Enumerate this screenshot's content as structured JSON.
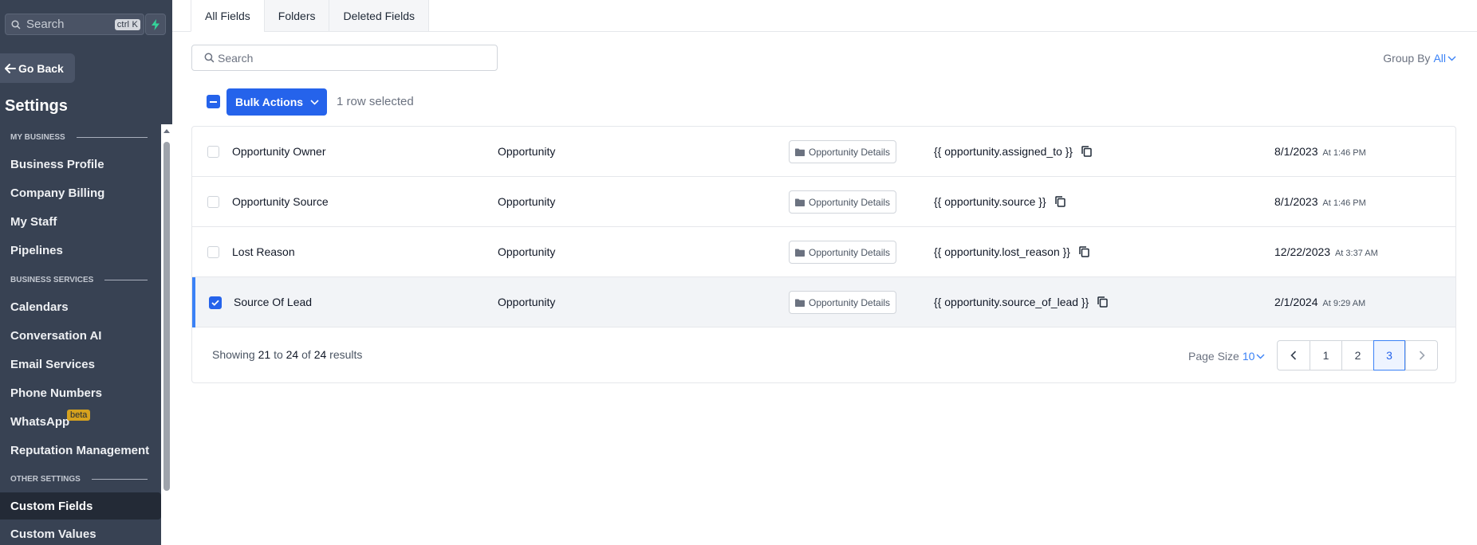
{
  "sidebar": {
    "search_placeholder": "Search",
    "search_shortcut": "ctrl K",
    "go_back": "Go Back",
    "title": "Settings",
    "sections": {
      "my_business": "MY BUSINESS",
      "business_services": "BUSINESS SERVICES",
      "other_settings": "OTHER SETTINGS"
    },
    "items": {
      "business_profile": "Business Profile",
      "company_billing": "Company Billing",
      "my_staff": "My Staff",
      "pipelines": "Pipelines",
      "calendars": "Calendars",
      "conversation_ai": "Conversation AI",
      "email_services": "Email Services",
      "phone_numbers": "Phone Numbers",
      "whatsapp": "WhatsApp",
      "whatsapp_badge": "beta",
      "reputation_management": "Reputation Management",
      "custom_fields": "Custom Fields",
      "custom_values": "Custom Values"
    },
    "active_item": "Custom Fields"
  },
  "tabs": [
    "All Fields",
    "Folders",
    "Deleted Fields"
  ],
  "active_tab": "All Fields",
  "search": {
    "placeholder": "Search"
  },
  "group_by": {
    "label": "Group By",
    "value": "All"
  },
  "bulk": {
    "label": "Bulk Actions",
    "selected_text": "1 row selected"
  },
  "rows": [
    {
      "name": "Opportunity Owner",
      "object": "Opportunity",
      "folder": "Opportunity Details",
      "key": "{{ opportunity.assigned_to }}",
      "date": "8/1/2023",
      "time": "At 1:46 PM",
      "checked": false
    },
    {
      "name": "Opportunity Source",
      "object": "Opportunity",
      "folder": "Opportunity Details",
      "key": "{{ opportunity.source }}",
      "date": "8/1/2023",
      "time": "At 1:46 PM",
      "checked": false
    },
    {
      "name": "Lost Reason",
      "object": "Opportunity",
      "folder": "Opportunity Details",
      "key": "{{ opportunity.lost_reason }}",
      "date": "12/22/2023",
      "time": "At 3:37 AM",
      "checked": false
    },
    {
      "name": "Source Of Lead",
      "object": "Opportunity",
      "folder": "Opportunity Details",
      "key": "{{ opportunity.source_of_lead }}",
      "date": "2/1/2024",
      "time": "At 9:29 AM",
      "checked": true
    }
  ],
  "footer": {
    "showing_prefix": "Showing",
    "from": "21",
    "to_word": "to",
    "to": "24",
    "of_word": "of",
    "total": "24",
    "suffix": "results",
    "page_size_label": "Page Size",
    "page_size": "10",
    "pages": [
      "1",
      "2",
      "3"
    ],
    "current_page": "3"
  },
  "colors": {
    "sidebar_bg": "#384253",
    "accent": "#2563eb",
    "beta_badge": "#d6a21e"
  },
  "icons": {
    "search": "search-icon",
    "bolt": "bolt-icon",
    "back": "arrow-left-icon",
    "folder": "folder-icon",
    "copy": "copy-icon",
    "chevron": "chevron-down-icon"
  }
}
